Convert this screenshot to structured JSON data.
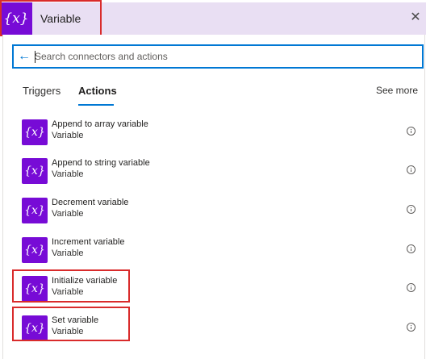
{
  "header": {
    "icon_glyph": "{x}",
    "title": "Variable",
    "close_glyph": "✕"
  },
  "search": {
    "back_glyph": "←",
    "placeholder": "Search connectors and actions"
  },
  "tabs": [
    {
      "label": "Triggers"
    },
    {
      "label": "Actions"
    }
  ],
  "see_more": "See more",
  "actions": [
    {
      "title": "Append to array variable",
      "subtitle": "Variable"
    },
    {
      "title": "Append to string variable",
      "subtitle": "Variable"
    },
    {
      "title": "Decrement variable",
      "subtitle": "Variable"
    },
    {
      "title": "Increment variable",
      "subtitle": "Variable"
    },
    {
      "title": "Initialize variable",
      "subtitle": "Variable"
    },
    {
      "title": "Set variable",
      "subtitle": "Variable"
    }
  ],
  "icon_glyph": "{x}",
  "colors": {
    "brand": "#770bd6",
    "header_bg": "#e9dff3",
    "accent": "#0078d4",
    "highlight": "#d92b2b"
  }
}
